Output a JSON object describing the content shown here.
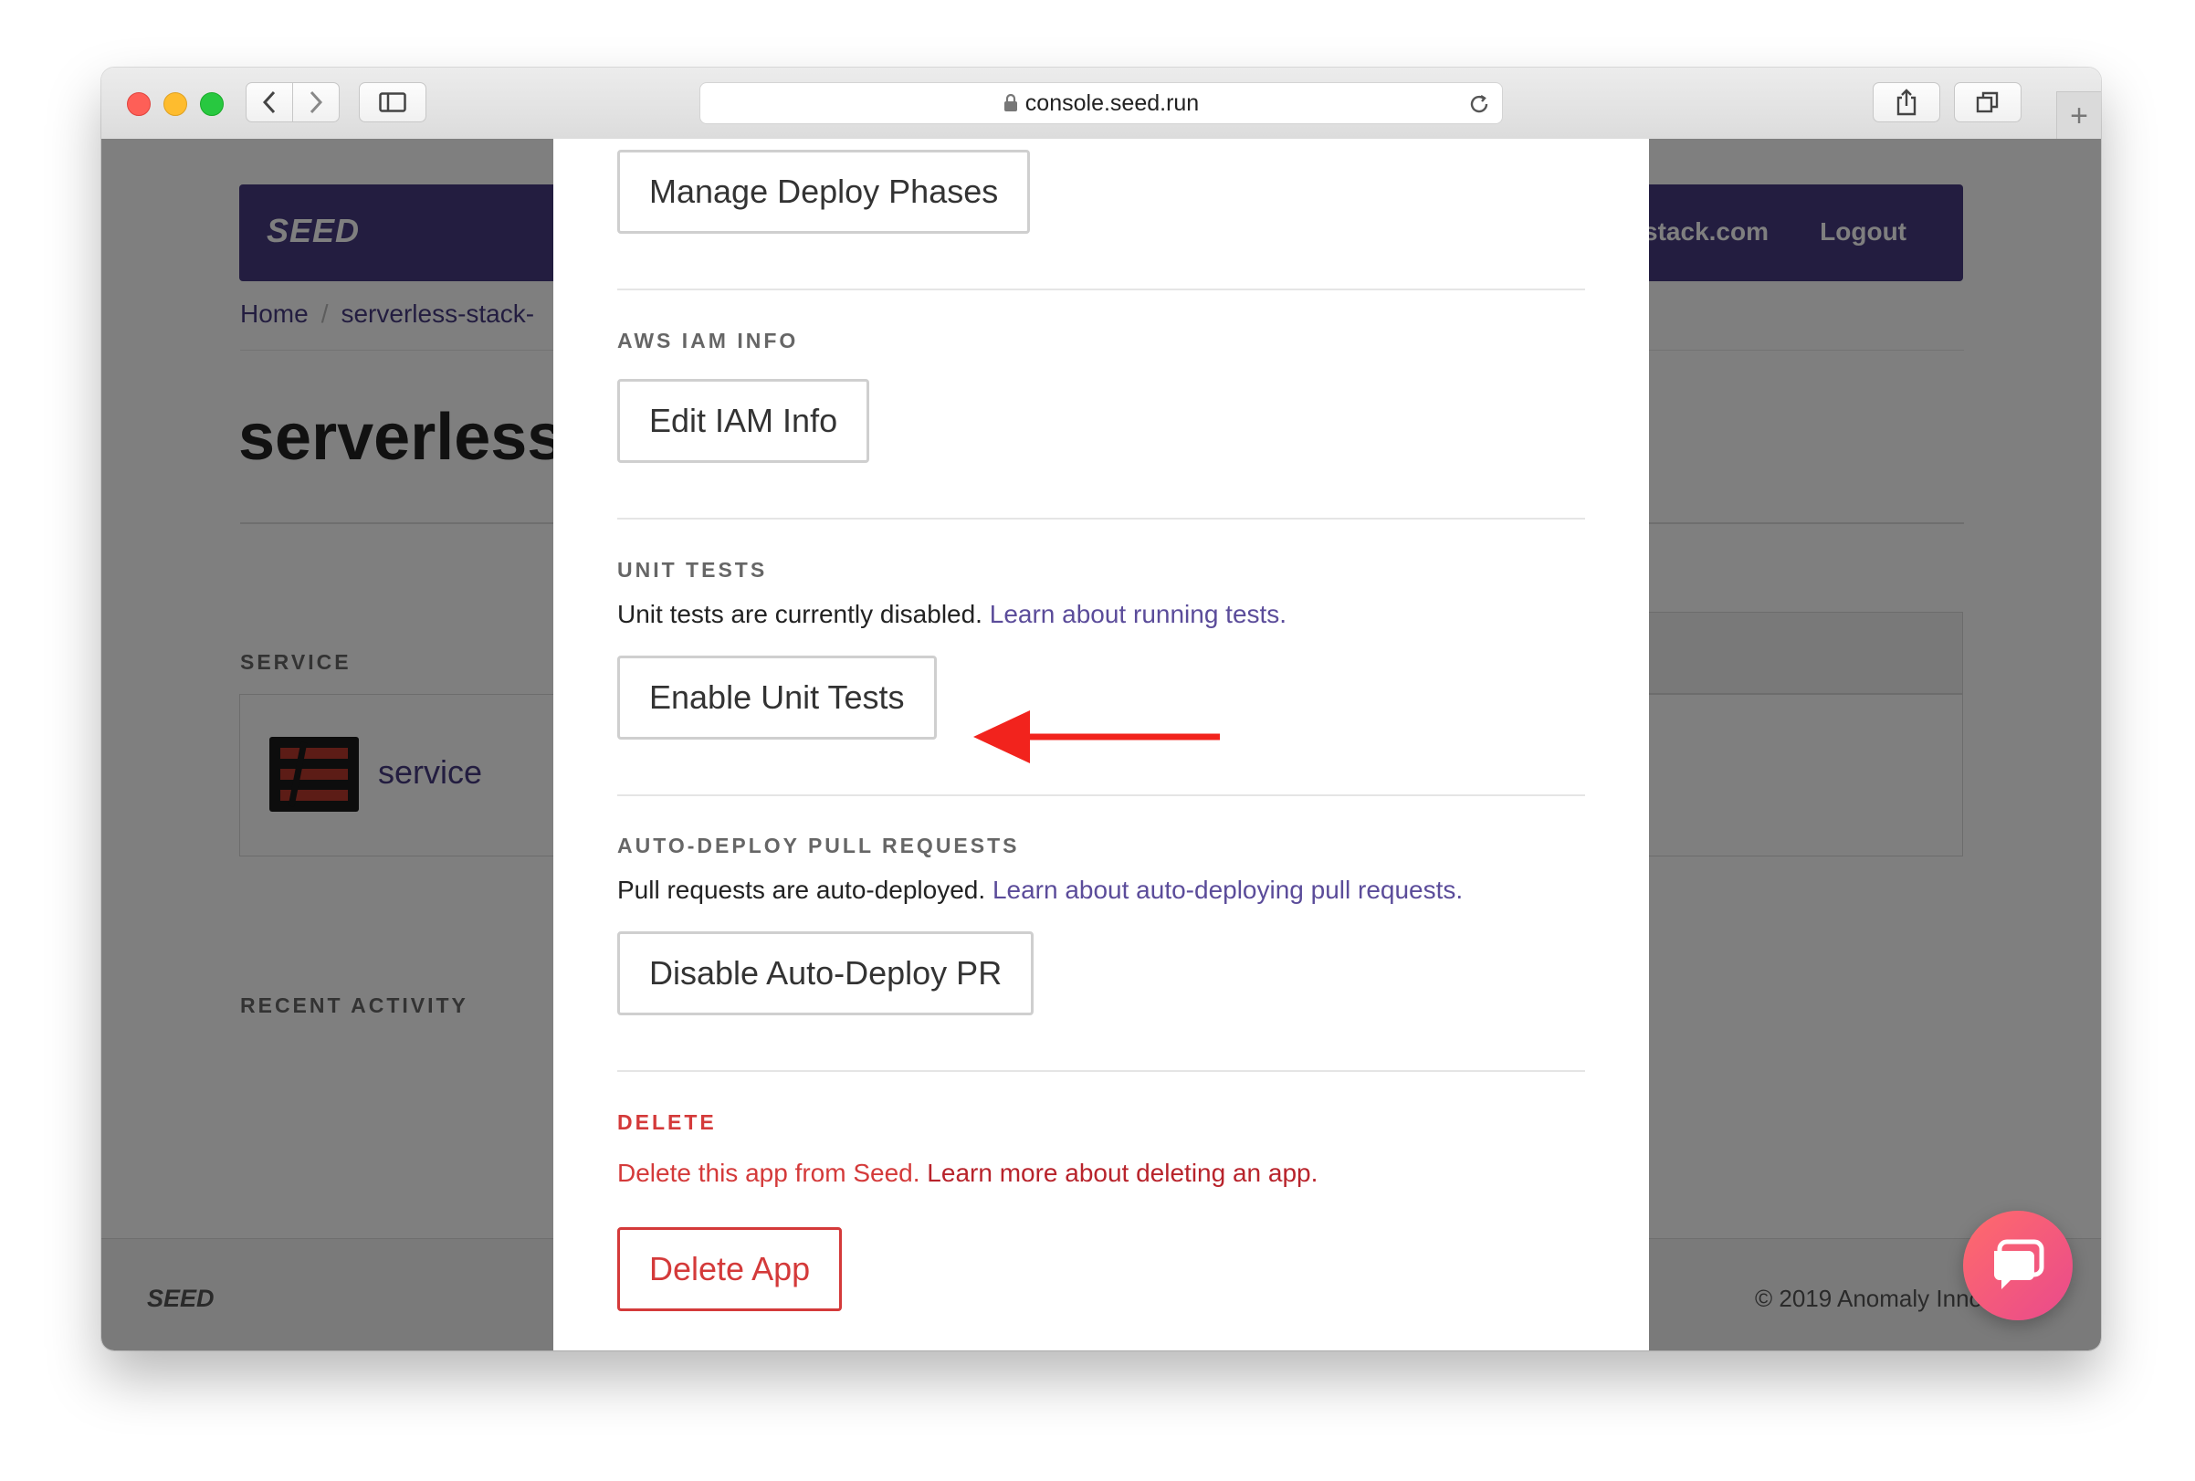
{
  "browser": {
    "url": "console.seed.run"
  },
  "navbar": {
    "brand": "SEED",
    "email_fragment": "stack.com",
    "logout": "Logout"
  },
  "breadcrumb": {
    "home": "Home",
    "sep": "/",
    "app": "serverless-stack-"
  },
  "page": {
    "title": "serverless",
    "service_label": "SERVICE",
    "service_name": "service",
    "recent_activity_label": "RECENT ACTIVITY"
  },
  "footer": {
    "brand": "SEED",
    "copyright": "© 2019 Anomaly Inno"
  },
  "modal": {
    "manage_phases_button": "Manage Deploy Phases",
    "iam": {
      "label": "AWS IAM INFO",
      "button": "Edit IAM Info"
    },
    "unit_tests": {
      "label": "UNIT TESTS",
      "text": "Unit tests are currently disabled.",
      "link": "Learn about running tests.",
      "button": "Enable Unit Tests"
    },
    "auto_deploy": {
      "label": "AUTO-DEPLOY PULL REQUESTS",
      "text": "Pull requests are auto-deployed.",
      "link": "Learn about auto-deploying pull requests.",
      "button": "Disable Auto-Deploy PR"
    },
    "delete": {
      "label": "DELETE",
      "text": "Delete this app from Seed.",
      "link": "Learn more about deleting an app.",
      "button": "Delete App"
    }
  },
  "colors": {
    "brand_purple": "#463b80",
    "link_purple": "#5b4c9a",
    "danger_red": "#d43a3a",
    "annotation_arrow": "#f2231d"
  }
}
